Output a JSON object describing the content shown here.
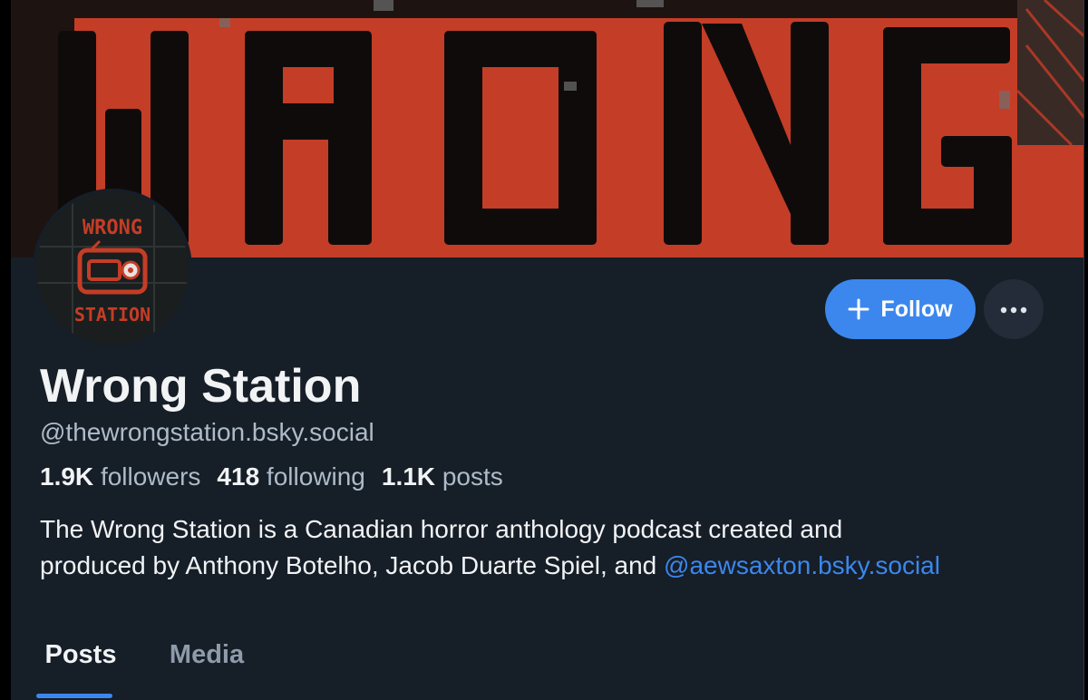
{
  "colors": {
    "background": "#161e27",
    "accent": "#3b87ee",
    "text_primary": "#f1f3f5",
    "text_secondary": "#aebbc9",
    "banner_red": "#c43d27"
  },
  "banner": {
    "logo_text": "WRONG"
  },
  "avatar": {
    "logo_top": "WRONG",
    "logo_bottom": "STATION"
  },
  "actions": {
    "follow_label": "Follow",
    "follow_icon": "plus-icon",
    "more_icon": "ellipsis-icon"
  },
  "profile": {
    "display_name": "Wrong Station",
    "handle": "@thewrongstation.bsky.social",
    "stats": {
      "followers_count": "1.9K",
      "followers_label": "followers",
      "following_count": "418",
      "following_label": "following",
      "posts_count": "1.1K",
      "posts_label": "posts"
    },
    "bio": {
      "line1": "The Wrong Station is a Canadian horror anthology podcast created and",
      "line2_text": "produced by Anthony Botelho, Jacob Duarte Spiel, and ",
      "line2_link": "@aewsaxton.bsky.social"
    }
  },
  "tabs": [
    {
      "label": "Posts",
      "active": true
    },
    {
      "label": "Media",
      "active": false
    }
  ]
}
